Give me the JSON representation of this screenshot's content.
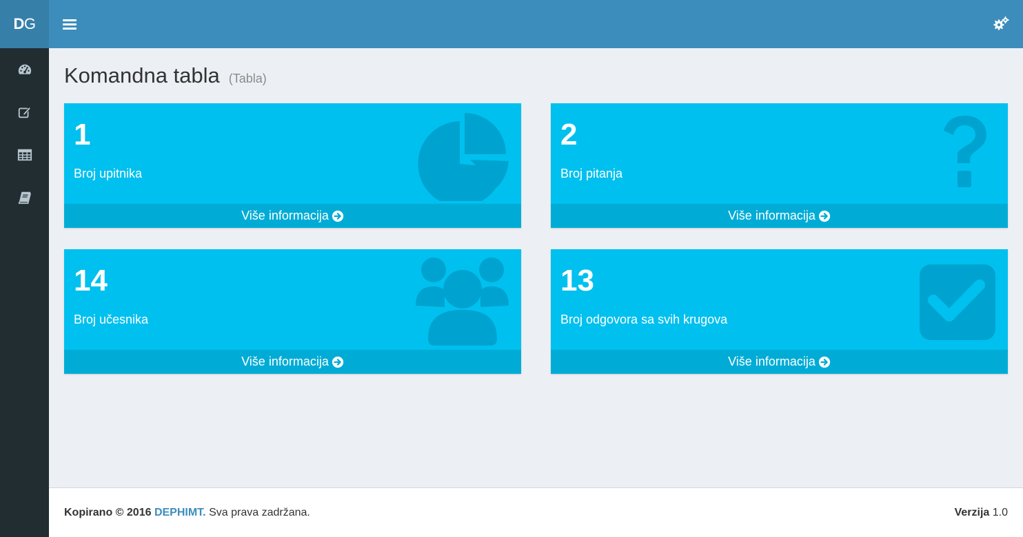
{
  "logo": {
    "bold": "D",
    "rest": "G"
  },
  "sidebar": {
    "items": [
      {
        "icon": "dashboard-icon"
      },
      {
        "icon": "edit-icon"
      },
      {
        "icon": "table-icon"
      },
      {
        "icon": "book-icon"
      }
    ]
  },
  "topbar": {
    "menu_icon": "hamburger-icon",
    "settings_icon": "gears-icon"
  },
  "page": {
    "title": "Komandna tabla",
    "subtitle": "(Tabla)"
  },
  "boxes": [
    {
      "number": "1",
      "label": "Broj upitnika",
      "link": "Više informacija",
      "icon": "pie-chart-icon"
    },
    {
      "number": "2",
      "label": "Broj pitanja",
      "link": "Više informacija",
      "icon": "question-icon"
    },
    {
      "number": "14",
      "label": "Broj učesnika",
      "link": "Više informacija",
      "icon": "users-icon"
    },
    {
      "number": "13",
      "label": "Broj odgovora sa svih krugova",
      "link": "Više informacija",
      "icon": "checkbox-icon"
    }
  ],
  "footer": {
    "copyright": "Kopirano © 2016",
    "brand": "DEPHIMT.",
    "rights": "Sva prava zadržana.",
    "version_label": "Verzija",
    "version_value": "1.0"
  },
  "colors": {
    "sidebar": "#222d32",
    "topbar": "#3c8dbc",
    "box": "#00c0ef",
    "box_footer": "#00acd6",
    "box_icon": "#00a3cf",
    "content_bg": "#ecf0f5"
  }
}
